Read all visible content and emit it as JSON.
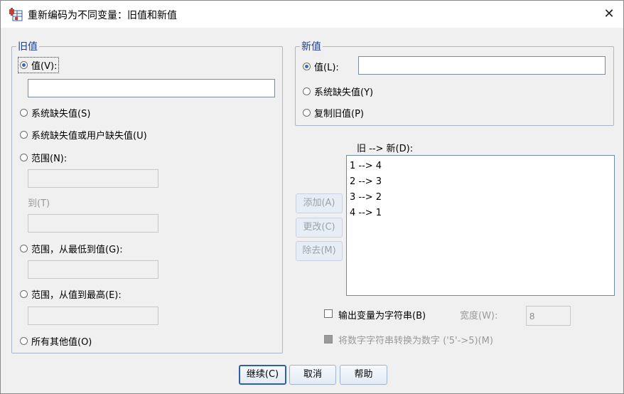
{
  "title": "重新编码为不同变量：旧值和新值",
  "old": {
    "legend": "旧值",
    "value_label": "值(V):",
    "value_input": "",
    "system_missing": "系统缺失值(S)",
    "system_or_user_missing": "系统缺失值或用户缺失值(U)",
    "range_label": "范围(N):",
    "range_from": "",
    "range_to_label": "到(T)",
    "range_to": "",
    "range_lowest_label": "范围，从最低到值(G):",
    "range_lowest": "",
    "range_highest_label": "范围，从值到最高(E):",
    "range_highest": "",
    "all_other": "所有其他值(O)"
  },
  "new": {
    "legend": "新值",
    "value_label": "值(L):",
    "value_input": "",
    "system_missing": "系统缺失值(Y)",
    "copy_old": "复制旧值(P)"
  },
  "mapping": {
    "label": "旧 --> 新(D):",
    "items": [
      "1 --> 4",
      "2 --> 3",
      "3 --> 2",
      "4 --> 1"
    ],
    "add": "添加(A)",
    "change": "更改(C)",
    "remove": "除去(M)"
  },
  "options": {
    "output_string": "输出变量为字符串(B)",
    "width_label": "宽度(W):",
    "width_value": "8",
    "convert_numeric": "将数字字符串转换为数字 ('5'->5)(M)"
  },
  "buttons": {
    "continue": "继续(C)",
    "cancel": "取消",
    "help": "帮助"
  }
}
